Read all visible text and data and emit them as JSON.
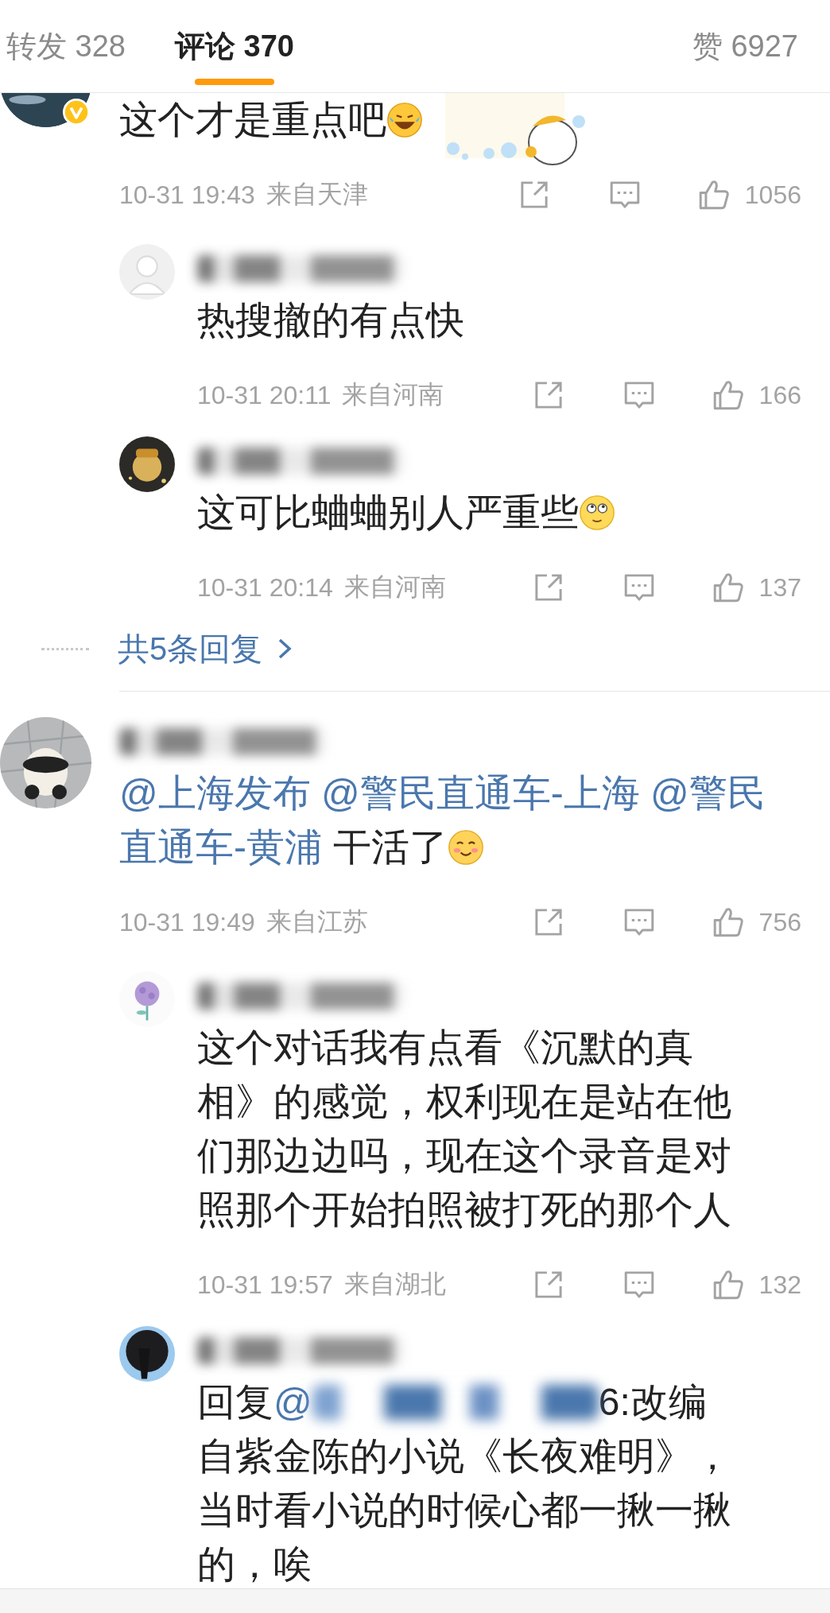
{
  "tabs": [
    {
      "label": "转发 328",
      "selected": false
    },
    {
      "label": "评论 370",
      "selected": true
    },
    {
      "label": "赞 6927",
      "selected": false
    }
  ],
  "comments": [
    {
      "avatar": {
        "kind": "landscape"
      },
      "verified": true,
      "clipped_top": true,
      "decorated": true,
      "segments": [
        {
          "kind": "text",
          "text": "这个才是重点吧"
        },
        {
          "kind": "laughing_emoji"
        }
      ],
      "time": "10-31 19:43",
      "location": "来自天津",
      "likes": "1056",
      "replies": [
        {
          "avatar": {
            "kind": "default"
          },
          "segments": [
            {
              "kind": "text",
              "text": "热搜撤的有点快"
            }
          ],
          "time": "10-31 20:11",
          "location": "来自河南",
          "likes": "166"
        },
        {
          "avatar": {
            "kind": "figure"
          },
          "segments": [
            {
              "kind": "text",
              "text": "这可比蛐蛐别人严重些"
            },
            {
              "kind": "eyes_up_emoji"
            }
          ],
          "time": "10-31 20:14",
          "location": "来自河南",
          "likes": "137"
        }
      ],
      "more_replies": "共5条回复"
    },
    {
      "avatar": {
        "kind": "panda"
      },
      "verified": false,
      "clipped_top": false,
      "decorated": false,
      "segments": [
        {
          "kind": "mention",
          "text": "@上海发布 "
        },
        {
          "kind": "mention",
          "text": "@警民直通车-上海 "
        },
        {
          "kind": "mention",
          "text": "@警民"
        },
        {
          "kind": "mention",
          "text": "直通车-黄浦"
        },
        {
          "kind": "text",
          "text": " 干活了"
        },
        {
          "kind": "smiling_emoji"
        }
      ],
      "time": "10-31 19:49",
      "location": "来自江苏",
      "likes": "756",
      "replies": [
        {
          "avatar": {
            "kind": "flower"
          },
          "segments": [
            {
              "kind": "text",
              "text": "这个对话我有点看《沉默的真相》的感觉，权利现在是站在他们那边边吗，现在这个录音是对照那个开始拍照被打死的那个人"
            }
          ],
          "time": "10-31 19:57",
          "location": "来自湖北",
          "likes": "132"
        },
        {
          "avatar": {
            "kind": "dark"
          },
          "segments": [
            {
              "kind": "text",
              "text": "回复"
            },
            {
              "kind": "mention",
              "text": "@"
            },
            {
              "kind": "redacted"
            },
            {
              "kind": "text",
              "text": "6:改编自紫金陈的小说《长夜难明》，当时看小说的时候心都一揪一揪的，唉"
            }
          ]
        }
      ]
    }
  ]
}
